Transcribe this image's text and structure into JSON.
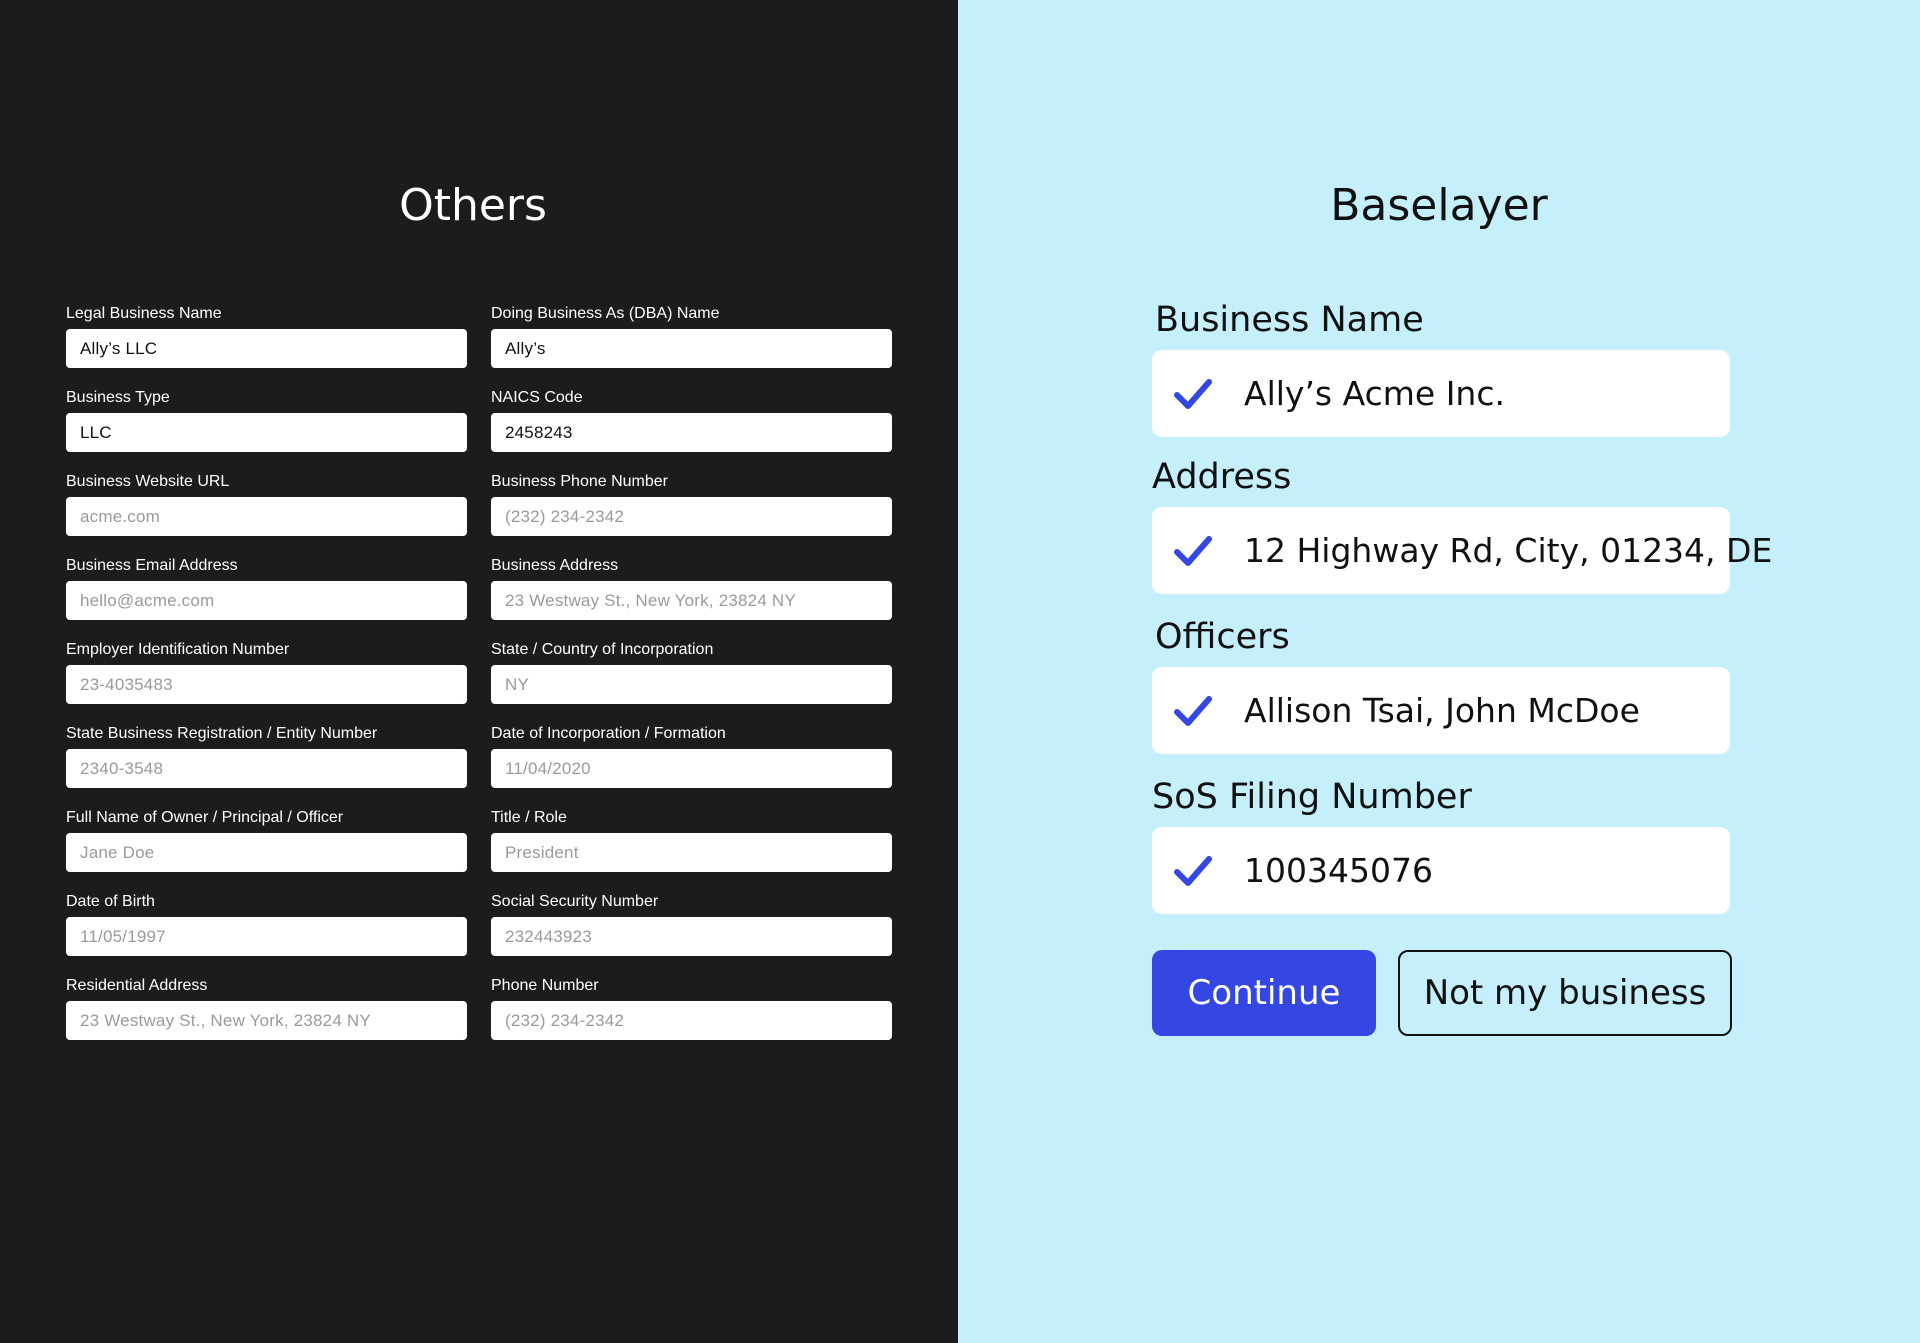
{
  "others": {
    "title": "Others",
    "fields": [
      {
        "label": "Legal Business Name",
        "value": "Ally’s LLC",
        "placeholder": ""
      },
      {
        "label": "Doing Business As (DBA) Name",
        "value": "Ally’s",
        "placeholder": ""
      },
      {
        "label": "Business Type",
        "value": "LLC",
        "placeholder": ""
      },
      {
        "label": "NAICS Code",
        "value": "2458243",
        "placeholder": ""
      },
      {
        "label": "Business Website URL",
        "value": "",
        "placeholder": "acme.com"
      },
      {
        "label": "Business Phone Number",
        "value": "",
        "placeholder": "(232) 234-2342"
      },
      {
        "label": "Business Email Address",
        "value": "",
        "placeholder": "hello@acme.com"
      },
      {
        "label": "Business Address",
        "value": "",
        "placeholder": "23 Westway St., New York, 23824 NY"
      },
      {
        "label": "Employer Identification Number",
        "value": "",
        "placeholder": "23-4035483"
      },
      {
        "label": "State / Country of Incorporation",
        "value": "",
        "placeholder": "NY"
      },
      {
        "label": "State Business Registration / Entity Number",
        "value": "",
        "placeholder": "2340-3548"
      },
      {
        "label": "Date of Incorporation / Formation",
        "value": "",
        "placeholder": "11/04/2020"
      },
      {
        "label": "Full Name of Owner / Principal / Officer",
        "value": "",
        "placeholder": "Jane Doe"
      },
      {
        "label": "Title / Role",
        "value": "",
        "placeholder": "President"
      },
      {
        "label": "Date of Birth",
        "value": "",
        "placeholder": "11/05/1997"
      },
      {
        "label": "Social Security Number",
        "value": "",
        "placeholder": "232443923"
      },
      {
        "label": "Residential Address",
        "value": "",
        "placeholder": "23 Westway St., New York, 23824 NY"
      },
      {
        "label": "Phone Number",
        "value": "",
        "placeholder": "(232) 234-2342"
      }
    ]
  },
  "baselayer": {
    "title": "Baselayer",
    "check_icon": "check-icon",
    "sections": [
      {
        "label": "Business Name",
        "value": "Ally’s Acme Inc."
      },
      {
        "label": "Address",
        "value": "12 Highway Rd, City, 01234, DE"
      },
      {
        "label": "Officers",
        "value": "Allison Tsai, John McDoe"
      },
      {
        "label": "SoS Filing Number",
        "value": "100345076"
      }
    ],
    "continue_label": "Continue",
    "not_my_business_label": "Not my business"
  },
  "colors": {
    "left_bg": "#1c1c1c",
    "right_bg": "#c6effc",
    "accent": "#3447e2"
  }
}
